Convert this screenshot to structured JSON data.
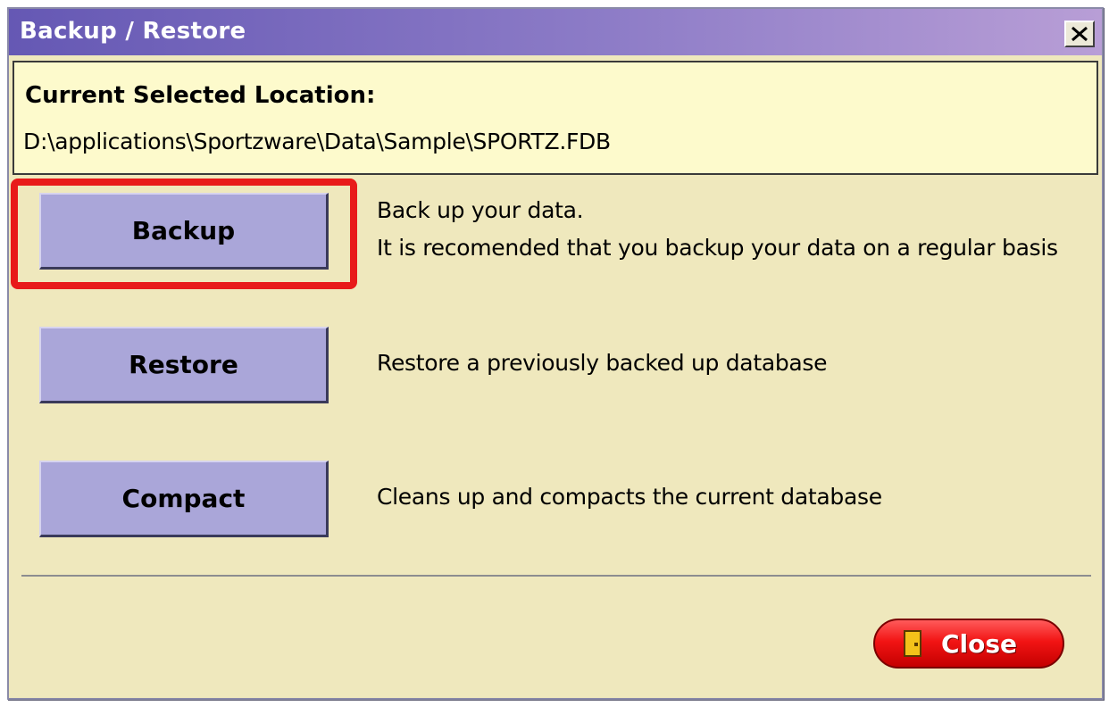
{
  "window": {
    "title": "Backup / Restore",
    "close_icon": "close-x-icon"
  },
  "location": {
    "label": "Current Selected Location:",
    "path": "D:\\applications\\Sportzware\\Data\\Sample\\SPORTZ.FDB"
  },
  "actions": [
    {
      "label": "Backup",
      "description_line1": "Back up your data.",
      "description_line2": "It is recomended that you backup your data on a regular basis"
    },
    {
      "label": "Restore",
      "description_line1": "Restore a previously backed up database"
    },
    {
      "label": "Compact",
      "description_line1": "Cleans up and compacts the current database"
    }
  ],
  "footer": {
    "close_label": "Close",
    "close_icon": "door-icon"
  },
  "colors": {
    "title_gradient_start": "#6558b4",
    "title_gradient_end": "#b89ed6",
    "window_bg": "#efe8bd",
    "location_bg": "#fdfacc",
    "action_button_bg": "#aaa6d9",
    "highlight_border": "#e81a1a",
    "close_button": "#f21414"
  }
}
